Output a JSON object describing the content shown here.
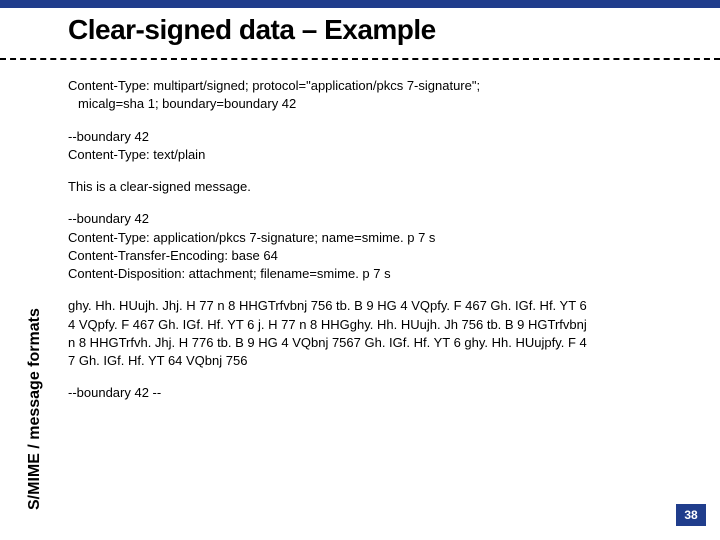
{
  "title": "Clear-signed data – Example",
  "sidebar": "S/MIME / message formats",
  "body": {
    "hdr1_line1": "Content-Type: multipart/signed; protocol=\"application/pkcs 7-signature\";",
    "hdr1_line2": "micalg=sha 1; boundary=boundary 42",
    "boundary1": "--boundary 42",
    "part1_ct": "Content-Type: text/plain",
    "message": "This is a clear-signed message.",
    "boundary2": "--boundary 42",
    "part2_ct": "Content-Type: application/pkcs 7-signature; name=smime. p 7 s",
    "part2_cte": "Content-Transfer-Encoding: base 64",
    "part2_cd": "Content-Disposition: attachment; filename=smime. p 7 s",
    "b64_l1": "ghy. Hh. HUujh. Jhj. H 77 n 8 HHGTrfvbnj 756 tb. B 9 HG 4 VQpfy. F 467 Gh. IGf. Hf. YT 6",
    "b64_l2": "4 VQpfy. F 467 Gh. IGf. Hf. YT 6 j. H 77 n 8 HHGghy. Hh. HUujh. Jh 756 tb. B 9 HGTrfvbnj",
    "b64_l3": "n 8 HHGTrfvh. Jhj. H 776 tb. B 9 HG 4 VQbnj 7567 Gh. IGf. Hf. YT 6 ghy. Hh. HUujpfy. F 4",
    "b64_l4": "7 Gh. IGf. Hf. YT 64 VQbnj 756",
    "boundary_end": "--boundary 42 --"
  },
  "page_number": "38"
}
